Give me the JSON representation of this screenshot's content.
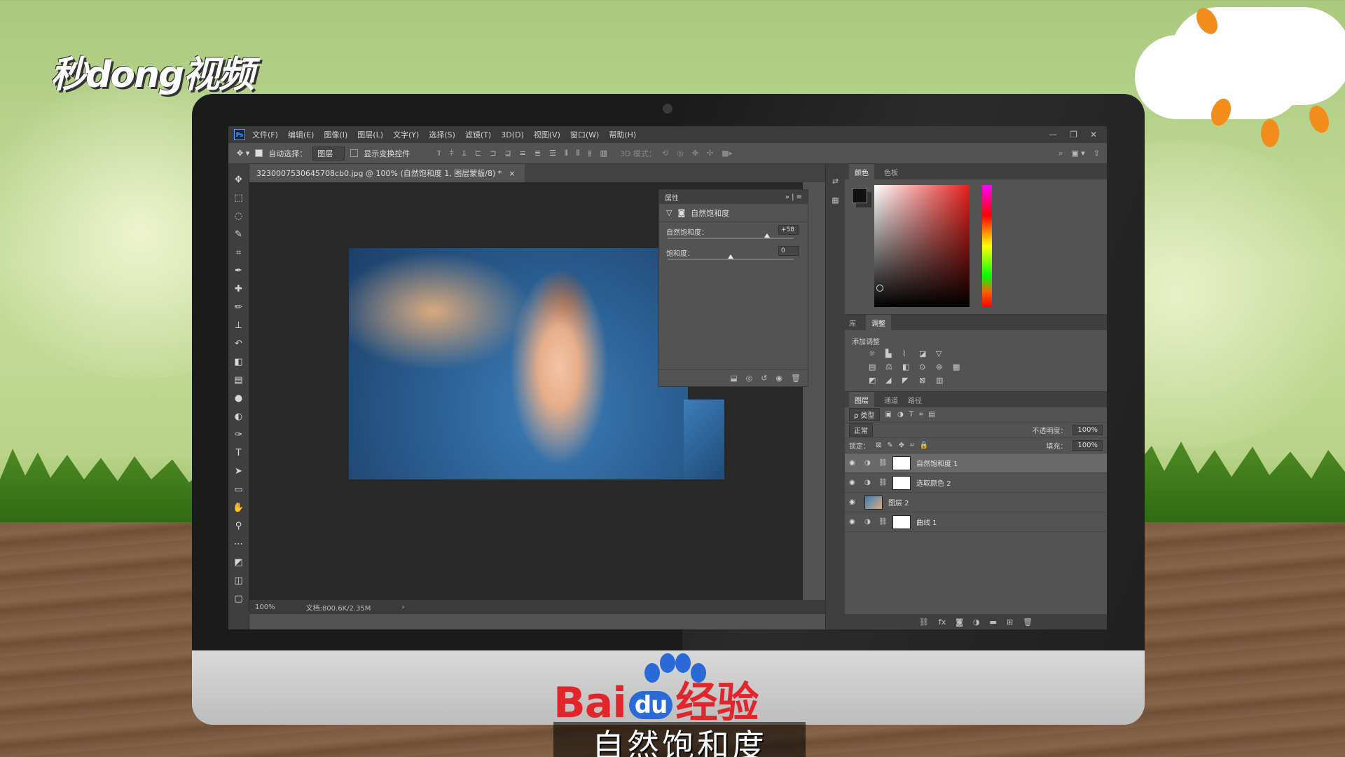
{
  "watermark_top": "秒dong视频",
  "app": {
    "logo": "Ps",
    "menu": [
      "文件(F)",
      "编辑(E)",
      "图像(I)",
      "图层(L)",
      "文字(Y)",
      "选择(S)",
      "滤镜(T)",
      "3D(D)",
      "视图(V)",
      "窗口(W)",
      "帮助(H)"
    ],
    "window_controls": [
      "—",
      "❐",
      "✕"
    ]
  },
  "options_bar": {
    "auto_select_label": "自动选择：",
    "auto_select_value": "图层",
    "show_transform_label": "显示变换控件",
    "mode_3d_label": "3D 模式："
  },
  "document": {
    "tab_title": "3230007530645708cb0.jpg @ 100% (自然饱和度 1, 图层蒙版/8) *",
    "tab_close": "×",
    "zoom": "100%",
    "doc_size": "文档:800.6K/2.35M"
  },
  "properties": {
    "header": "属性",
    "header_icons": "»  |  ≡",
    "layer_name": "自然饱和度",
    "vibrance_label": "自然饱和度：",
    "vibrance_value": "+58",
    "vibrance_level_pct": 79,
    "saturation_label": "饱和度：",
    "saturation_value": "0",
    "saturation_level_pct": 50
  },
  "color_panel": {
    "tabs": [
      "颜色",
      "色板"
    ]
  },
  "adjustments_panel": {
    "tabs": [
      "库",
      "调整"
    ],
    "label": "添加调整"
  },
  "layers_panel": {
    "tabs": [
      "图层",
      "通道",
      "路径"
    ],
    "filter_label": "ρ 类型",
    "blend_mode": "正常",
    "opacity_label": "不透明度：",
    "opacity_value": "100%",
    "lock_label": "锁定：",
    "fill_label": "填充：",
    "fill_value": "100%",
    "layers": [
      {
        "name": "自然饱和度 1",
        "selected": true,
        "kind": "adjustment"
      },
      {
        "name": "选取颜色 2",
        "selected": false,
        "kind": "adjustment"
      },
      {
        "name": "图层 2",
        "selected": false,
        "kind": "photo"
      },
      {
        "name": "曲线 1",
        "selected": false,
        "kind": "adjustment"
      }
    ]
  },
  "watermark_bottom": {
    "brand_left": "Bai",
    "brand_mid": "du",
    "brand_right": "经验",
    "subtitle": "自然饱和度"
  }
}
